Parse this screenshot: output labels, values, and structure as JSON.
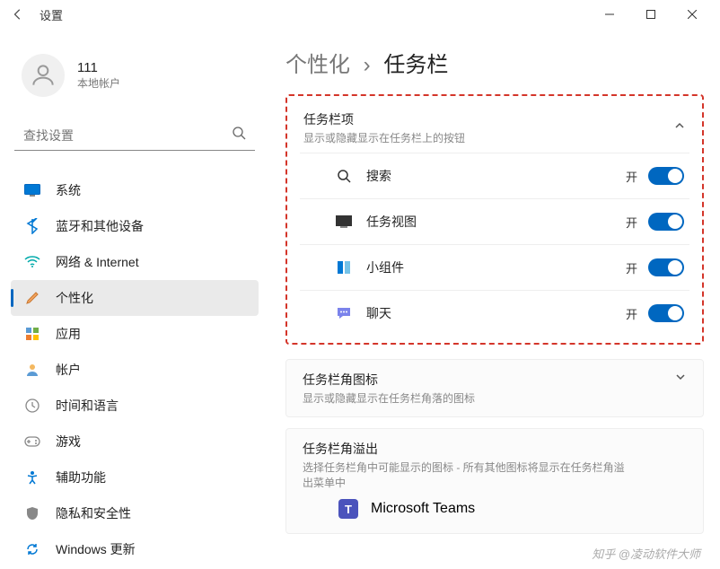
{
  "window": {
    "title": "设置"
  },
  "user": {
    "name": "111",
    "type": "本地帐户"
  },
  "search": {
    "placeholder": "查找设置"
  },
  "nav": [
    {
      "label": "系统"
    },
    {
      "label": "蓝牙和其他设备"
    },
    {
      "label": "网络 & Internet"
    },
    {
      "label": "个性化"
    },
    {
      "label": "应用"
    },
    {
      "label": "帐户"
    },
    {
      "label": "时间和语言"
    },
    {
      "label": "游戏"
    },
    {
      "label": "辅助功能"
    },
    {
      "label": "隐私和安全性"
    },
    {
      "label": "Windows 更新"
    }
  ],
  "breadcrumb": {
    "parent": "个性化",
    "current": "任务栏"
  },
  "taskbarItems": {
    "title": "任务栏项",
    "subtitle": "显示或隐藏显示在任务栏上的按钮",
    "rows": [
      {
        "label": "搜索",
        "state": "开"
      },
      {
        "label": "任务视图",
        "state": "开"
      },
      {
        "label": "小组件",
        "state": "开"
      },
      {
        "label": "聊天",
        "state": "开"
      }
    ]
  },
  "cornerIcons": {
    "title": "任务栏角图标",
    "subtitle": "显示或隐藏显示在任务栏角落的图标"
  },
  "overflow": {
    "title": "任务栏角溢出",
    "subtitle": "选择任务栏角中可能显示的图标 - 所有其他图标将显示在任务栏角溢出菜单中",
    "app": "Microsoft Teams"
  },
  "watermark": "知乎 @凌动软件大师"
}
